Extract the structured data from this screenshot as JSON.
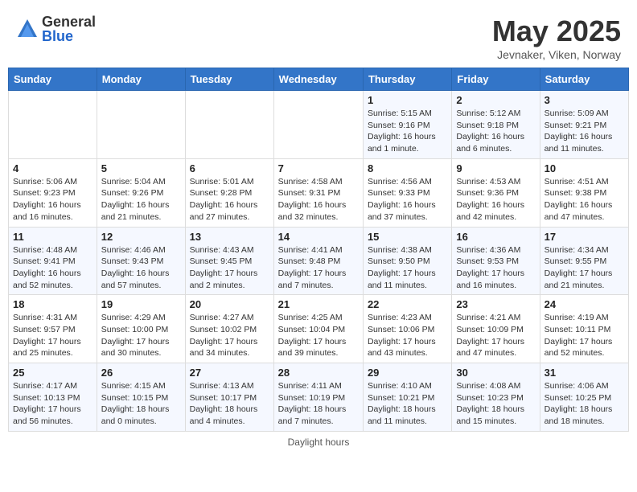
{
  "header": {
    "logo_general": "General",
    "logo_blue": "Blue",
    "month_title": "May 2025",
    "location": "Jevnaker, Viken, Norway"
  },
  "days_of_week": [
    "Sunday",
    "Monday",
    "Tuesday",
    "Wednesday",
    "Thursday",
    "Friday",
    "Saturday"
  ],
  "weeks": [
    [
      {
        "day": "",
        "info": ""
      },
      {
        "day": "",
        "info": ""
      },
      {
        "day": "",
        "info": ""
      },
      {
        "day": "",
        "info": ""
      },
      {
        "day": "1",
        "info": "Sunrise: 5:15 AM\nSunset: 9:16 PM\nDaylight: 16 hours\nand 1 minute."
      },
      {
        "day": "2",
        "info": "Sunrise: 5:12 AM\nSunset: 9:18 PM\nDaylight: 16 hours\nand 6 minutes."
      },
      {
        "day": "3",
        "info": "Sunrise: 5:09 AM\nSunset: 9:21 PM\nDaylight: 16 hours\nand 11 minutes."
      }
    ],
    [
      {
        "day": "4",
        "info": "Sunrise: 5:06 AM\nSunset: 9:23 PM\nDaylight: 16 hours\nand 16 minutes."
      },
      {
        "day": "5",
        "info": "Sunrise: 5:04 AM\nSunset: 9:26 PM\nDaylight: 16 hours\nand 21 minutes."
      },
      {
        "day": "6",
        "info": "Sunrise: 5:01 AM\nSunset: 9:28 PM\nDaylight: 16 hours\nand 27 minutes."
      },
      {
        "day": "7",
        "info": "Sunrise: 4:58 AM\nSunset: 9:31 PM\nDaylight: 16 hours\nand 32 minutes."
      },
      {
        "day": "8",
        "info": "Sunrise: 4:56 AM\nSunset: 9:33 PM\nDaylight: 16 hours\nand 37 minutes."
      },
      {
        "day": "9",
        "info": "Sunrise: 4:53 AM\nSunset: 9:36 PM\nDaylight: 16 hours\nand 42 minutes."
      },
      {
        "day": "10",
        "info": "Sunrise: 4:51 AM\nSunset: 9:38 PM\nDaylight: 16 hours\nand 47 minutes."
      }
    ],
    [
      {
        "day": "11",
        "info": "Sunrise: 4:48 AM\nSunset: 9:41 PM\nDaylight: 16 hours\nand 52 minutes."
      },
      {
        "day": "12",
        "info": "Sunrise: 4:46 AM\nSunset: 9:43 PM\nDaylight: 16 hours\nand 57 minutes."
      },
      {
        "day": "13",
        "info": "Sunrise: 4:43 AM\nSunset: 9:45 PM\nDaylight: 17 hours\nand 2 minutes."
      },
      {
        "day": "14",
        "info": "Sunrise: 4:41 AM\nSunset: 9:48 PM\nDaylight: 17 hours\nand 7 minutes."
      },
      {
        "day": "15",
        "info": "Sunrise: 4:38 AM\nSunset: 9:50 PM\nDaylight: 17 hours\nand 11 minutes."
      },
      {
        "day": "16",
        "info": "Sunrise: 4:36 AM\nSunset: 9:53 PM\nDaylight: 17 hours\nand 16 minutes."
      },
      {
        "day": "17",
        "info": "Sunrise: 4:34 AM\nSunset: 9:55 PM\nDaylight: 17 hours\nand 21 minutes."
      }
    ],
    [
      {
        "day": "18",
        "info": "Sunrise: 4:31 AM\nSunset: 9:57 PM\nDaylight: 17 hours\nand 25 minutes."
      },
      {
        "day": "19",
        "info": "Sunrise: 4:29 AM\nSunset: 10:00 PM\nDaylight: 17 hours\nand 30 minutes."
      },
      {
        "day": "20",
        "info": "Sunrise: 4:27 AM\nSunset: 10:02 PM\nDaylight: 17 hours\nand 34 minutes."
      },
      {
        "day": "21",
        "info": "Sunrise: 4:25 AM\nSunset: 10:04 PM\nDaylight: 17 hours\nand 39 minutes."
      },
      {
        "day": "22",
        "info": "Sunrise: 4:23 AM\nSunset: 10:06 PM\nDaylight: 17 hours\nand 43 minutes."
      },
      {
        "day": "23",
        "info": "Sunrise: 4:21 AM\nSunset: 10:09 PM\nDaylight: 17 hours\nand 47 minutes."
      },
      {
        "day": "24",
        "info": "Sunrise: 4:19 AM\nSunset: 10:11 PM\nDaylight: 17 hours\nand 52 minutes."
      }
    ],
    [
      {
        "day": "25",
        "info": "Sunrise: 4:17 AM\nSunset: 10:13 PM\nDaylight: 17 hours\nand 56 minutes."
      },
      {
        "day": "26",
        "info": "Sunrise: 4:15 AM\nSunset: 10:15 PM\nDaylight: 18 hours\nand 0 minutes."
      },
      {
        "day": "27",
        "info": "Sunrise: 4:13 AM\nSunset: 10:17 PM\nDaylight: 18 hours\nand 4 minutes."
      },
      {
        "day": "28",
        "info": "Sunrise: 4:11 AM\nSunset: 10:19 PM\nDaylight: 18 hours\nand 7 minutes."
      },
      {
        "day": "29",
        "info": "Sunrise: 4:10 AM\nSunset: 10:21 PM\nDaylight: 18 hours\nand 11 minutes."
      },
      {
        "day": "30",
        "info": "Sunrise: 4:08 AM\nSunset: 10:23 PM\nDaylight: 18 hours\nand 15 minutes."
      },
      {
        "day": "31",
        "info": "Sunrise: 4:06 AM\nSunset: 10:25 PM\nDaylight: 18 hours\nand 18 minutes."
      }
    ]
  ],
  "footer": {
    "note": "Daylight hours"
  }
}
